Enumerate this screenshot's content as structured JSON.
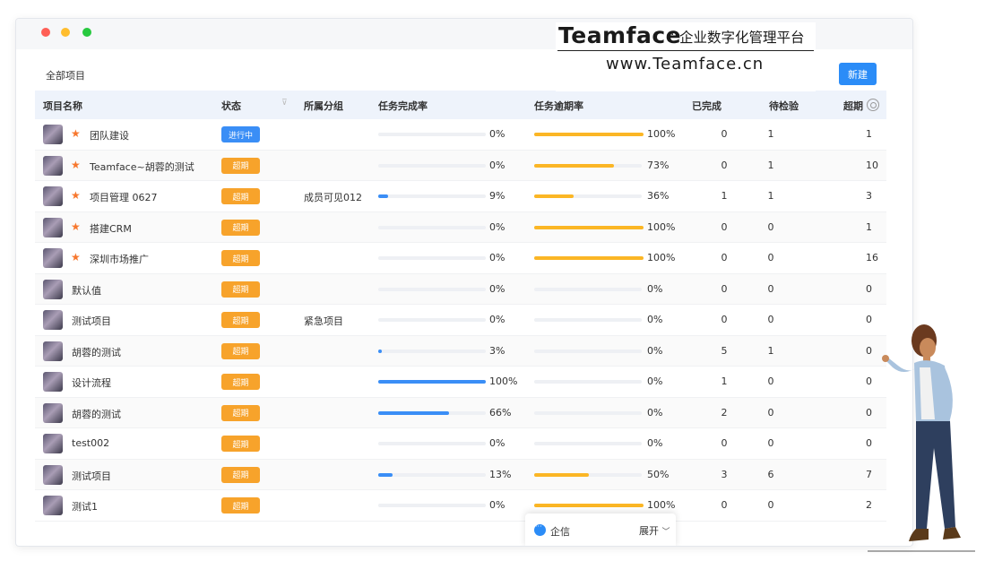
{
  "header": {
    "label": "全部项目",
    "new_button": "新建"
  },
  "brand": {
    "name": "Teamface",
    "separator": "·",
    "tagline": "企业数字化管理平台",
    "url": "www.Teamface.cn"
  },
  "columns": [
    "项目名称",
    "状态",
    "所属分组",
    "任务完成率",
    "任务逾期率",
    "已完成",
    "待检验",
    "超期"
  ],
  "status_labels": {
    "in_progress": "进行中",
    "overdue": "超期"
  },
  "rows": [
    {
      "name": "团队建设",
      "starred": true,
      "status": "进行中",
      "status_type": "progress",
      "group": "",
      "completion": 0,
      "completion_text": "0%",
      "overdue": 100,
      "overdue_text": "100%",
      "done": "0",
      "pending": "1",
      "late": "1"
    },
    {
      "name": "Teamface~胡蓉的测试",
      "starred": true,
      "status": "超期",
      "status_type": "overdue",
      "group": "",
      "completion": 0,
      "completion_text": "0%",
      "overdue": 73,
      "overdue_text": "73%",
      "done": "0",
      "pending": "1",
      "late": "10"
    },
    {
      "name": "项目管理 0627",
      "starred": true,
      "status": "超期",
      "status_type": "overdue",
      "group": "成员可见012",
      "completion": 9,
      "completion_text": "9%",
      "overdue": 36,
      "overdue_text": "36%",
      "done": "1",
      "pending": "1",
      "late": "3"
    },
    {
      "name": "搭建CRM",
      "starred": true,
      "status": "超期",
      "status_type": "overdue",
      "group": "",
      "completion": 0,
      "completion_text": "0%",
      "overdue": 100,
      "overdue_text": "100%",
      "done": "0",
      "pending": "0",
      "late": "1"
    },
    {
      "name": "深圳市场推广",
      "starred": true,
      "status": "超期",
      "status_type": "overdue",
      "group": "",
      "completion": 0,
      "completion_text": "0%",
      "overdue": 100,
      "overdue_text": "100%",
      "done": "0",
      "pending": "0",
      "late": "16"
    },
    {
      "name": "默认值",
      "starred": false,
      "status": "超期",
      "status_type": "overdue",
      "group": "",
      "completion": 0,
      "completion_text": "0%",
      "overdue": 0,
      "overdue_text": "0%",
      "done": "0",
      "pending": "0",
      "late": "0"
    },
    {
      "name": "测试项目",
      "starred": false,
      "status": "超期",
      "status_type": "overdue",
      "group": "紧急项目",
      "completion": 0,
      "completion_text": "0%",
      "overdue": 0,
      "overdue_text": "0%",
      "done": "0",
      "pending": "0",
      "late": "0"
    },
    {
      "name": "胡蓉的测试",
      "starred": false,
      "status": "超期",
      "status_type": "overdue",
      "group": "",
      "completion": 3,
      "completion_text": "3%",
      "overdue": 0,
      "overdue_text": "0%",
      "done": "5",
      "pending": "1",
      "late": "0"
    },
    {
      "name": "设计流程",
      "starred": false,
      "status": "超期",
      "status_type": "overdue",
      "group": "",
      "completion": 100,
      "completion_text": "100%",
      "overdue": 0,
      "overdue_text": "0%",
      "done": "1",
      "pending": "0",
      "late": "0"
    },
    {
      "name": "胡蓉的测试",
      "starred": false,
      "status": "超期",
      "status_type": "overdue",
      "group": "",
      "completion": 66,
      "completion_text": "66%",
      "overdue": 0,
      "overdue_text": "0%",
      "done": "2",
      "pending": "0",
      "late": "0"
    },
    {
      "name": "test002",
      "starred": false,
      "status": "超期",
      "status_type": "overdue",
      "group": "",
      "completion": 0,
      "completion_text": "0%",
      "overdue": 0,
      "overdue_text": "0%",
      "done": "0",
      "pending": "0",
      "late": "0"
    },
    {
      "name": "测试项目",
      "starred": false,
      "status": "超期",
      "status_type": "overdue",
      "group": "",
      "completion": 13,
      "completion_text": "13%",
      "overdue": 50,
      "overdue_text": "50%",
      "done": "3",
      "pending": "6",
      "late": "7"
    },
    {
      "name": "测试1",
      "starred": false,
      "status": "超期",
      "status_type": "overdue",
      "group": "",
      "completion": 0,
      "completion_text": "0%",
      "overdue": 100,
      "overdue_text": "100%",
      "done": "0",
      "pending": "0",
      "late": "2"
    }
  ],
  "chat": {
    "label": "企信",
    "expand": "展开"
  },
  "colors": {
    "accent": "#2b8cf7",
    "overdue_badge": "#f7a32b",
    "completion_bar": "#3a8ef6",
    "overdue_bar": "#fbb625",
    "star": "#f7772d"
  }
}
